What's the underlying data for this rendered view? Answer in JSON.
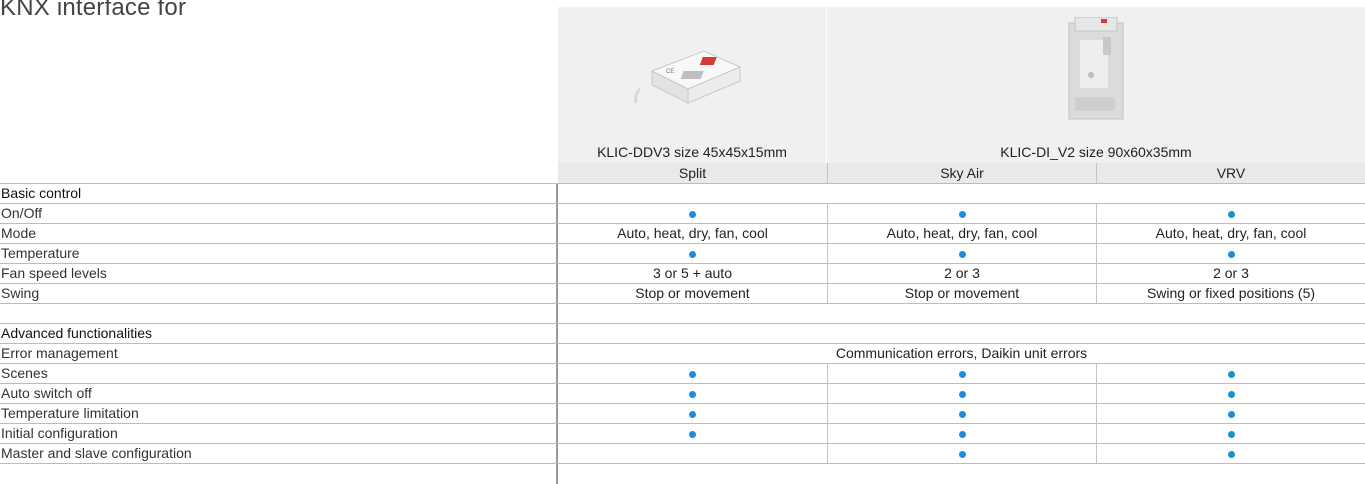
{
  "title": "KNX interface for",
  "products": [
    {
      "name": "KLIC-DDV3 size 45x45x15mm",
      "image_icon": "klic-ddv3-device-icon"
    },
    {
      "name": "KLIC-DI_V2 size 90x60x35mm",
      "image_icon": "klic-di-v2-device-icon"
    }
  ],
  "columns": [
    "Split",
    "Sky Air",
    "VRV"
  ],
  "sections": [
    {
      "name": "Basic control",
      "rows": [
        {
          "label": "On/Off",
          "values": [
            "dot",
            "dot",
            "dot"
          ]
        },
        {
          "label": "Mode",
          "values": [
            "Auto, heat, dry, fan, cool",
            "Auto, heat, dry, fan, cool",
            "Auto, heat, dry, fan, cool"
          ]
        },
        {
          "label": "Temperature",
          "values": [
            "dot",
            "dot",
            "dot"
          ]
        },
        {
          "label": "Fan speed levels",
          "values": [
            "3 or 5 + auto",
            "2 or 3",
            "2 or 3"
          ]
        },
        {
          "label": "Swing",
          "values": [
            "Stop or movement",
            "Stop or movement",
            "Swing or fixed positions (5)"
          ]
        }
      ]
    },
    {
      "name": "Advanced functionalities",
      "rows": [
        {
          "label": "Error management",
          "span": "Communication errors, Daikin unit errors"
        },
        {
          "label": "Scenes",
          "values": [
            "dot",
            "dot",
            "dot"
          ]
        },
        {
          "label": "Auto switch off",
          "values": [
            "dot",
            "dot",
            "dot"
          ]
        },
        {
          "label": "Temperature limitation",
          "values": [
            "dot",
            "dot",
            "dot"
          ]
        },
        {
          "label": "Initial configuration",
          "values": [
            "dot",
            "dot",
            "dot"
          ]
        },
        {
          "label": "Master and slave configuration",
          "values": [
            "",
            "dot",
            "dot"
          ]
        }
      ]
    }
  ],
  "colors": {
    "dot": "#1a8ed6",
    "header_bg": "#f0f0f0",
    "grid_line": "#bcbcbc"
  }
}
